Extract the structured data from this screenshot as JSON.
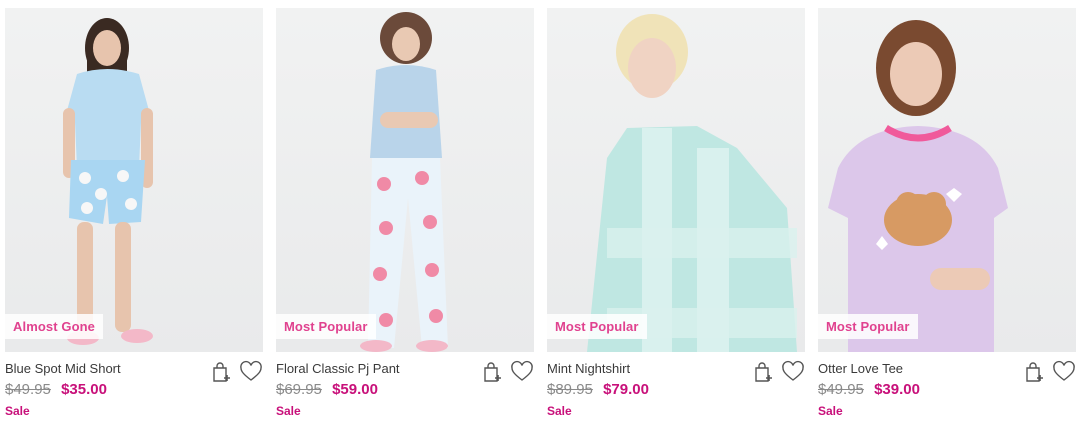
{
  "products": [
    {
      "badge": "Almost Gone",
      "name": "Blue Spot Mid Short",
      "was_price": "$49.95",
      "now_price": "$35.00",
      "status": "Sale",
      "icons": [
        "bag-add-icon",
        "heart-icon"
      ]
    },
    {
      "badge": "Most Popular",
      "name": "Floral Classic Pj Pant",
      "was_price": "$69.95",
      "now_price": "$59.00",
      "status": "Sale",
      "icons": [
        "bag-add-icon",
        "heart-icon"
      ]
    },
    {
      "badge": "Most Popular",
      "name": "Mint Nightshirt",
      "was_price": "$89.95",
      "now_price": "$79.00",
      "status": "Sale",
      "icons": [
        "bag-add-icon",
        "heart-icon"
      ]
    },
    {
      "badge": "Most Popular",
      "name": "Otter Love Tee",
      "was_price": "$49.95",
      "now_price": "$39.00",
      "status": "Sale",
      "icons": [
        "bag-add-icon",
        "heart-icon"
      ]
    }
  ],
  "colors": {
    "accent": "#c8107a",
    "badge_text": "#e0428f",
    "strike_price": "#8a8a8a"
  }
}
